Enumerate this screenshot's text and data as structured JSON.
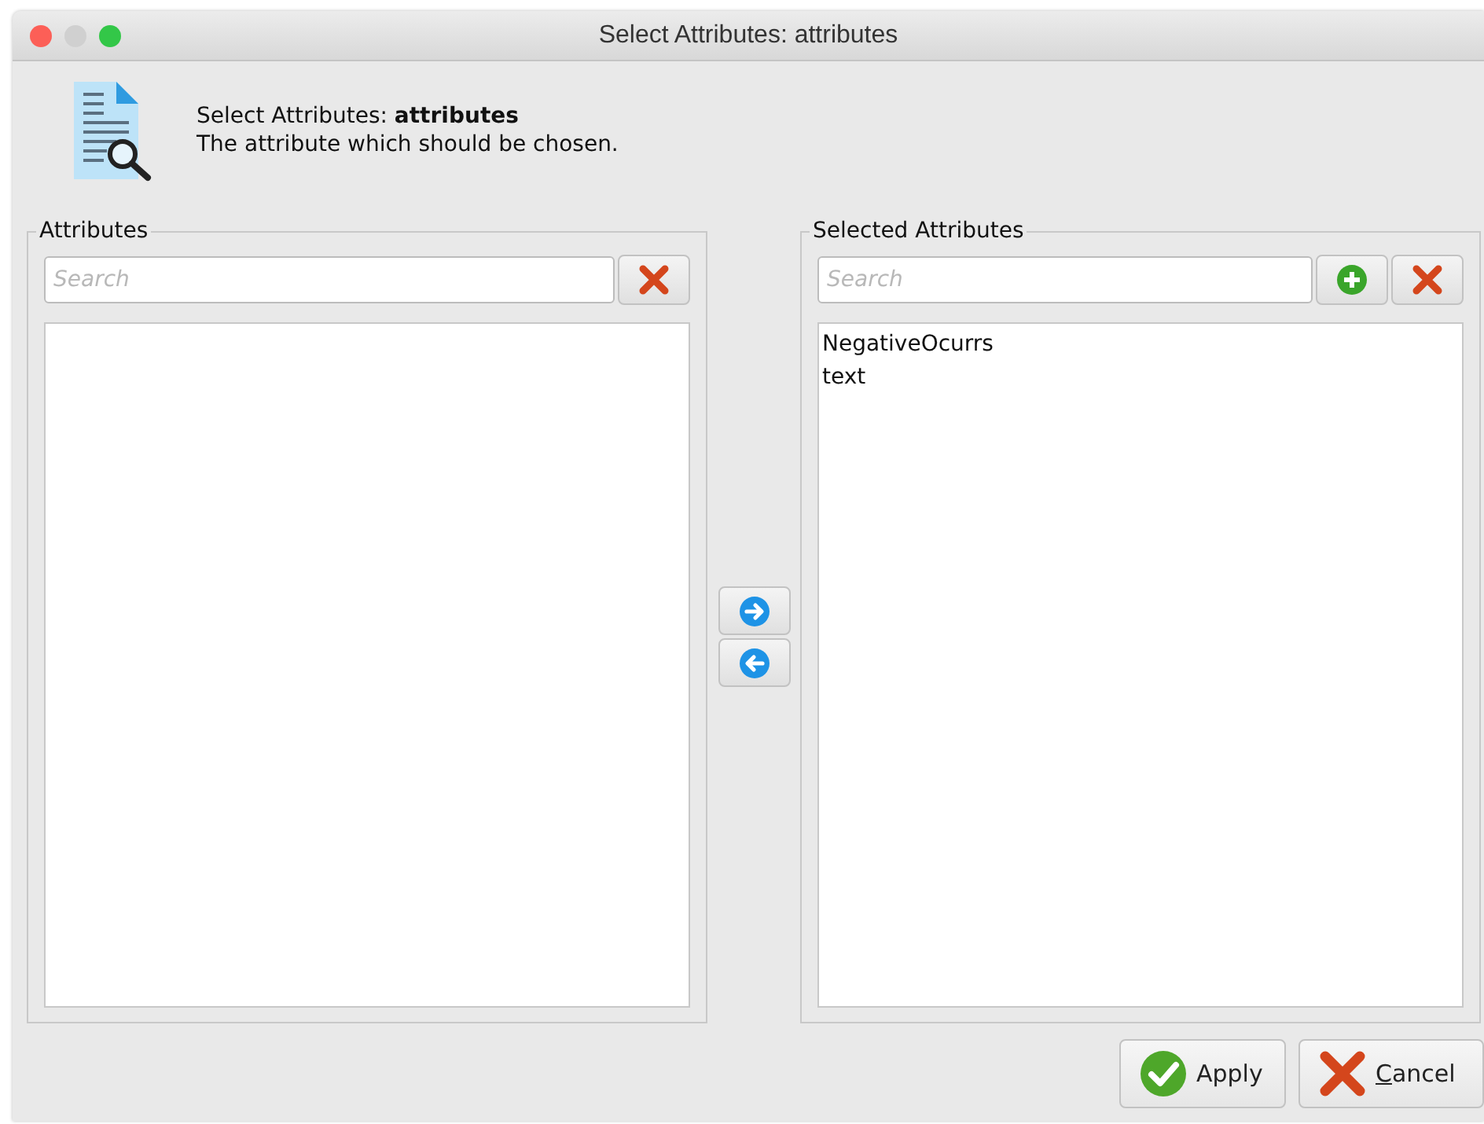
{
  "window": {
    "title": "Select Attributes: attributes"
  },
  "header": {
    "title": "Select Attributes: **attributes**",
    "description": "The attribute which should be chosen."
  },
  "attributes_panel": {
    "title": "Attributes",
    "search": {
      "placeholder": "Search"
    }
  },
  "selected_panel": {
    "title": "Selected Attributes",
    "search": {
      "placeholder": "Search"
    },
    "items": [
      "NegativeOcurrs",
      "text"
    ]
  },
  "buttons": [
    {
      "label": "Apply",
      "kind": "apply",
      "mnemonic_underlined": false
    },
    {
      "label": "Cancel",
      "kind": "cancel",
      "mnemonic_underlined": true
    }
  ]
}
